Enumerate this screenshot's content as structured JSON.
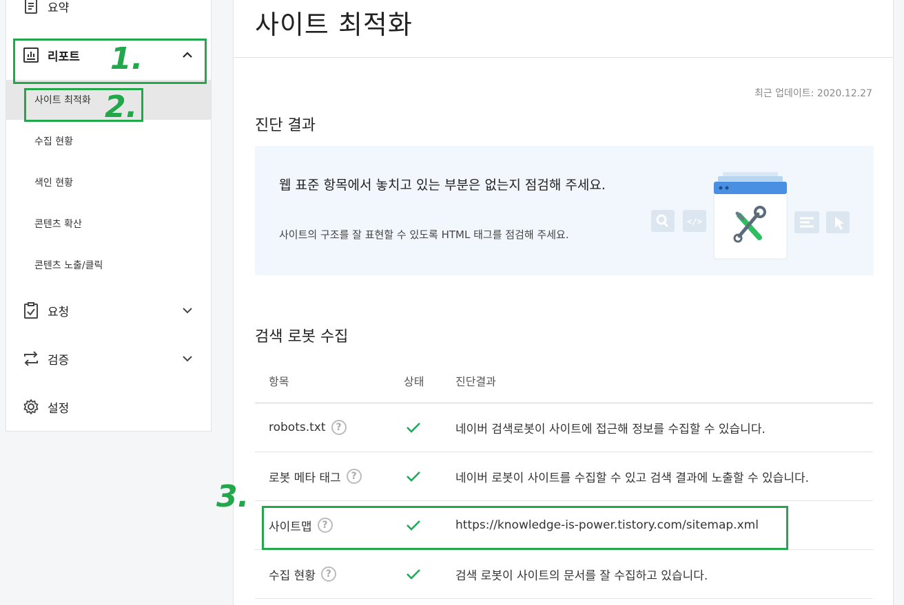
{
  "sidebar": {
    "summary_label": "요약",
    "report_label": "리포트",
    "report_subitems": [
      "사이트 최적화",
      "수집 현황",
      "색인 현황",
      "콘텐츠 확산",
      "콘텐츠 노출/클릭"
    ],
    "request_label": "요청",
    "verify_label": "검증",
    "settings_label": "설정"
  },
  "main": {
    "title": "사이트 최적화",
    "updated": "최근 업데이트: 2020.12.27",
    "diagnosis": {
      "title": "진단 결과",
      "headline": "웹 표준 항목에서 놓치고 있는 부분은 없는지 점검해 주세요.",
      "description": "사이트의 구조를 잘 표현할 수 있도록 HTML 태그를 점검해 주세요."
    },
    "crawl": {
      "title": "검색 로봇 수집",
      "columns": [
        "항목",
        "상태",
        "진단결과"
      ],
      "rows": [
        {
          "item": "robots.txt",
          "result": "네이버 검색로봇이 사이트에 접근해 정보를 수집할 수 있습니다."
        },
        {
          "item": "로봇 메타 태그",
          "result": "네이버 로봇이 사이트를 수집할 수 있고 검색 결과에 노출할 수 있습니다."
        },
        {
          "item": "사이트맵",
          "result": "https://knowledge-is-power.tistory.com/sitemap.xml"
        },
        {
          "item": "수집 현황",
          "result": "검색 로봇이 사이트의 문서를 잘 수집하고 있습니다."
        }
      ]
    }
  },
  "annotations": [
    "1.",
    "2.",
    "3."
  ],
  "colors": {
    "check": "#1ea85a",
    "annotation": "#22a84a",
    "diag_bg": "#f1f7fc"
  }
}
